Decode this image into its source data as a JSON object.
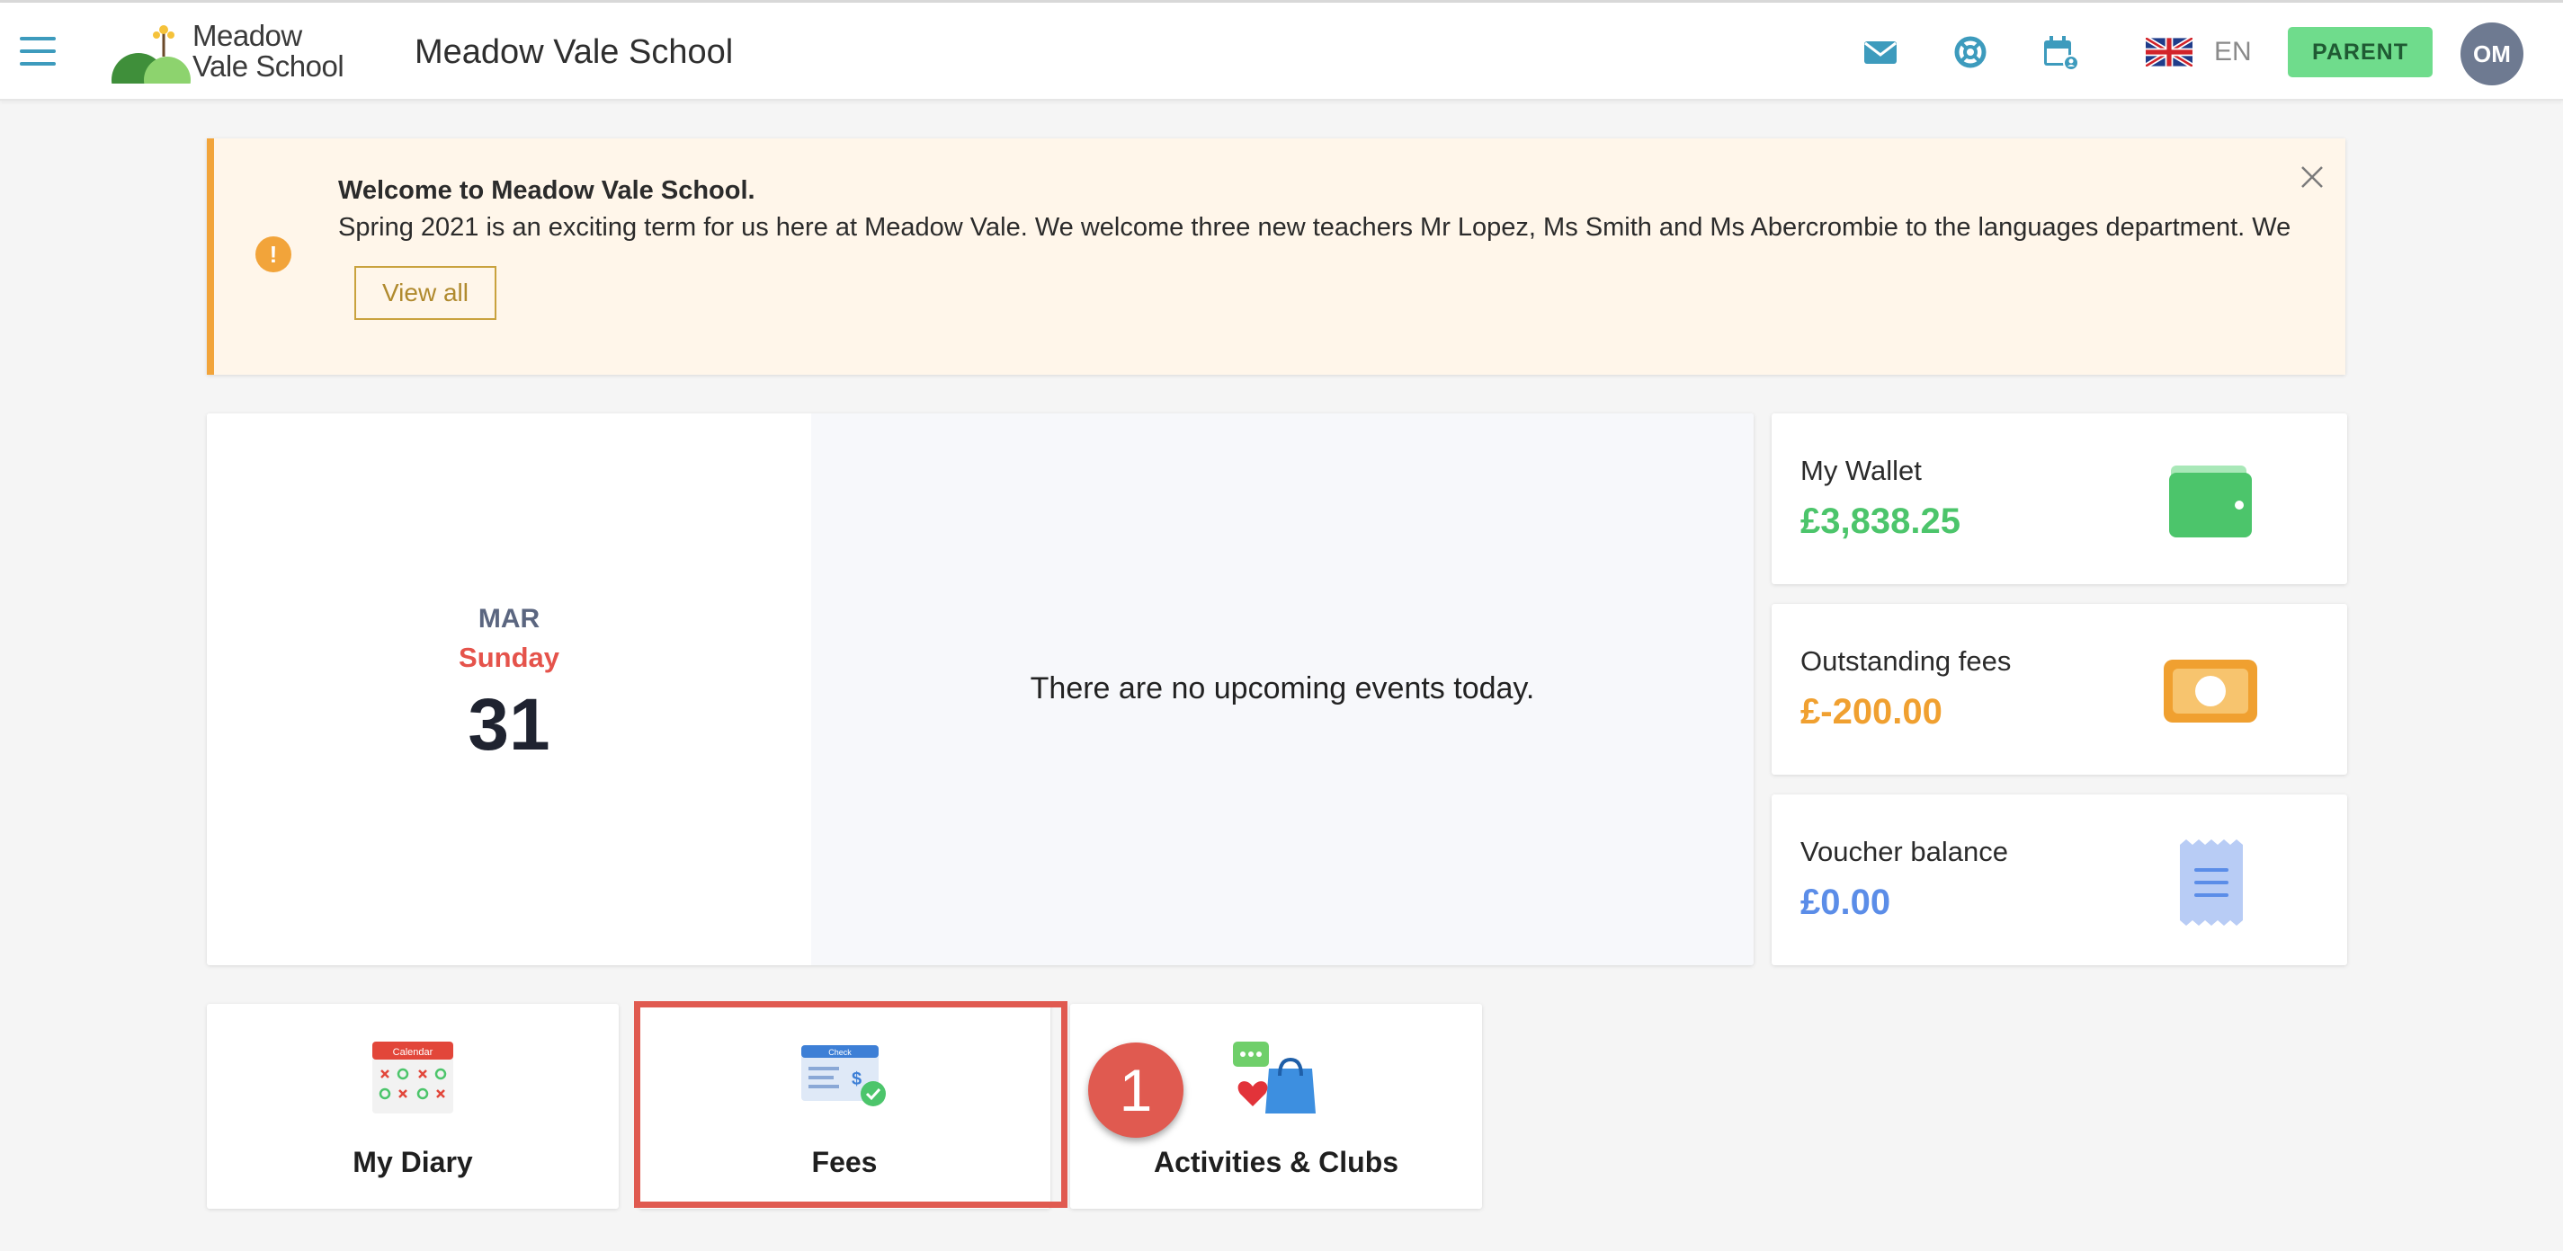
{
  "header": {
    "logo_line1": "Meadow",
    "logo_line2": "Vale School",
    "school_name": "Meadow Vale School",
    "icons": [
      "menu-icon",
      "mail-icon",
      "support-icon",
      "calendar-user-icon"
    ],
    "language": "EN",
    "role_button": "PARENT",
    "avatar_initials": "OM"
  },
  "banner": {
    "title": "Welcome to Meadow Vale School.",
    "text": "Spring 2021 is an exciting term for us here at Meadow Vale.  We welcome three new teachers Mr Lopez, Ms Smith and Ms Abercrombie to the languages department.  We",
    "view_all_label": "View all",
    "warning_symbol": "!"
  },
  "date": {
    "month": "MAR",
    "weekday": "Sunday",
    "day": "31",
    "empty_message": "There are no upcoming events today."
  },
  "stats": [
    {
      "label": "My Wallet",
      "value": "£3,838.25",
      "color": "#4cc56b",
      "icon": "wallet-icon"
    },
    {
      "label": "Outstanding fees",
      "value": "£-200.00",
      "color": "#f0a030",
      "icon": "banknote-icon"
    },
    {
      "label": "Voucher balance",
      "value": "£0.00",
      "color": "#5b8de8",
      "icon": "receipt-icon"
    }
  ],
  "tiles": [
    {
      "label": "My Diary",
      "icon": "calendar-icon",
      "icon_text": "Calendar"
    },
    {
      "label": "Fees",
      "icon": "check-bill-icon",
      "icon_text": "Check"
    },
    {
      "label": "Activities & Clubs",
      "icon": "shopping-bag-icon"
    }
  ],
  "annotation": {
    "step": "1"
  },
  "colors": {
    "accent": "#3d9bbd",
    "role_button": "#6fdc8c",
    "highlight": "#e05a50",
    "banner_border": "#f2a43a"
  }
}
